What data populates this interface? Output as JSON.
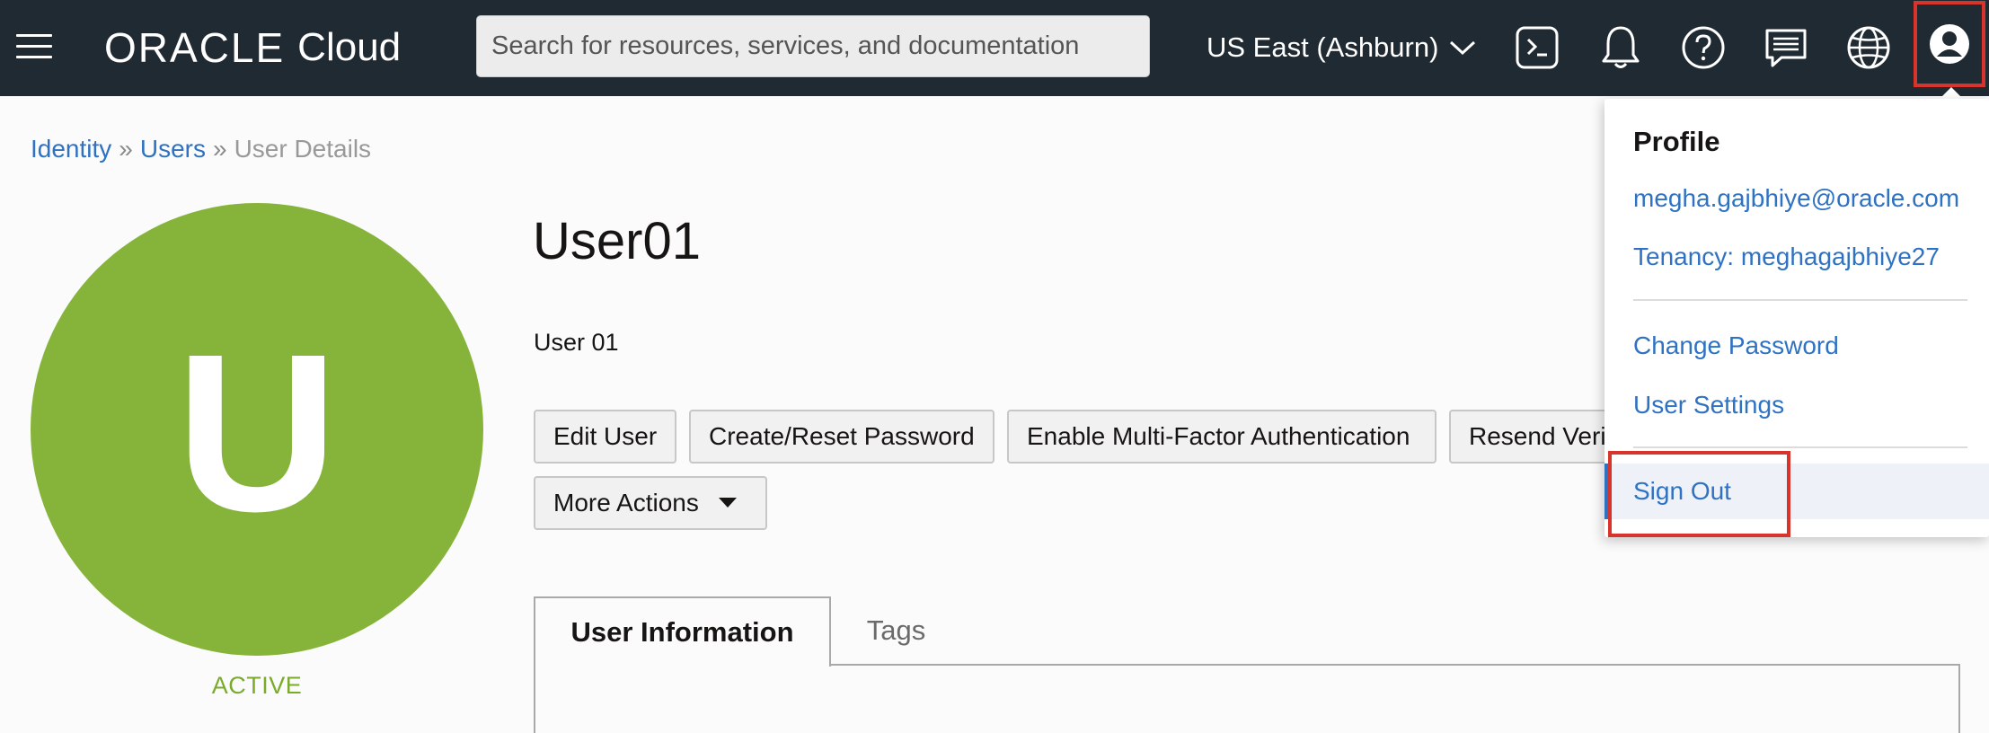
{
  "header": {
    "logo_primary": "ORACLE",
    "logo_secondary": "Cloud",
    "search_placeholder": "Search for resources, services, and documentation",
    "region": "US East (Ashburn)",
    "icons": [
      "hamburger-menu-icon",
      "cloud-shell-icon",
      "bell-icon",
      "help-icon",
      "chat-icon",
      "globe-icon",
      "user-profile-icon"
    ],
    "colors": {
      "background": "#202a33",
      "text": "#ffffff",
      "highlight": "#d9342b"
    }
  },
  "breadcrumb": {
    "items": [
      "Identity",
      "Users",
      "User Details"
    ],
    "separator": "»"
  },
  "user": {
    "initial": "U",
    "name": "User01",
    "description": "User 01",
    "status": "ACTIVE",
    "avatar_color": "#86b43b",
    "status_color": "#7aab2a"
  },
  "actions": {
    "edit_user": "Edit User",
    "create_reset_password": "Create/Reset Password",
    "enable_mfa": "Enable Multi-Factor Authentication",
    "resend_verification": "Resend Verification Email",
    "more_actions": "More Actions"
  },
  "tabs": [
    {
      "label": "User Information",
      "active": true
    },
    {
      "label": "Tags",
      "active": false
    }
  ],
  "profile_menu": {
    "heading": "Profile",
    "email": "megha.gajbhiye@oracle.com",
    "tenancy": "Tenancy: meghagajbhiye27",
    "change_password": "Change Password",
    "user_settings": "User Settings",
    "sign_out": "Sign Out",
    "link_color": "#2f72c2"
  }
}
